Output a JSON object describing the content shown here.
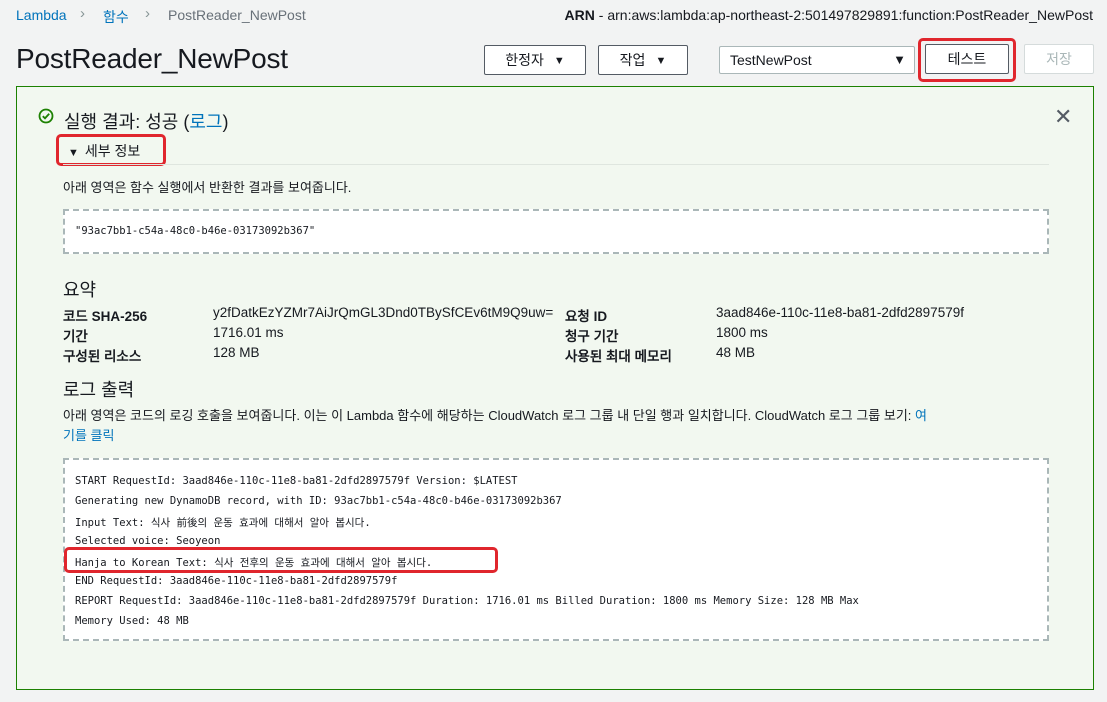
{
  "breadcrumb": {
    "items": [
      "Lambda",
      "함수",
      "PostReader_NewPost"
    ]
  },
  "arn": {
    "label": "ARN",
    "value": "arn:aws:lambda:ap-northeast-2:501497829891:function:PostReader_NewPost"
  },
  "page_title": "PostReader_NewPost",
  "toolbar": {
    "qualifier_label": "한정자",
    "actions_label": "작업",
    "test_event_selected": "TestNewPost",
    "test_label": "테스트",
    "save_label": "저장"
  },
  "result": {
    "title_prefix": "실행 결과: 성공 (",
    "log_link": "로그",
    "title_suffix": ")",
    "details_label": "세부 정보",
    "description": "아래 영역은 함수 실행에서 반환한 결과를 보여줍니다.",
    "return_value": "\"93ac7bb1-c54a-48c0-b46e-03173092b367\""
  },
  "summary": {
    "heading": "요약",
    "left": [
      {
        "key": "코드 SHA-256",
        "value": "y2fDatkEzYZMr7AiJrQmGL3Dnd0TBySfCEv6tM9Q9uw="
      },
      {
        "key": "기간",
        "value": "1716.01 ms"
      },
      {
        "key": "구성된 리소스",
        "value": "128 MB"
      }
    ],
    "right": [
      {
        "key": "요청 ID",
        "value": "3aad846e-110c-11e8-ba81-2dfd2897579f"
      },
      {
        "key": "청구 기간",
        "value": "1800 ms"
      },
      {
        "key": "사용된 최대 메모리",
        "value": "48 MB"
      }
    ]
  },
  "log_output": {
    "heading": "로그 출력",
    "description_line1": "아래 영역은 코드의 로깅 호출을 보여줍니다. 이는 이 Lambda 함수에 해당하는 CloudWatch 로그 그룹 내 단일 행과 일치합니다. CloudWatch 로그 그룹 보기: ",
    "link_part1": "여",
    "link_part2": "기를 클릭",
    "lines": [
      "START RequestId: 3aad846e-110c-11e8-ba81-2dfd2897579f Version: $LATEST",
      "Generating new DynamoDB record, with ID: 93ac7bb1-c54a-48c0-b46e-03173092b367",
      "Input Text: 식사 前後의 운동 효과에 대해서 알아 봅시다.",
      "Selected voice: Seoyeon",
      "Hanja to Korean Text: 식사 전후의 운동 효과에 대해서 알아 봅시다.",
      "END RequestId: 3aad846e-110c-11e8-ba81-2dfd2897579f",
      "REPORT RequestId: 3aad846e-110c-11e8-ba81-2dfd2897579f  Duration: 1716.01 ms    Billed Duration: 1800 ms        Memory Size: 128 MB      Max",
      "Memory Used: 48 MB"
    ]
  },
  "colors": {
    "link": "#0073bb",
    "success": "#1d8102",
    "highlight": "#e0262d"
  }
}
